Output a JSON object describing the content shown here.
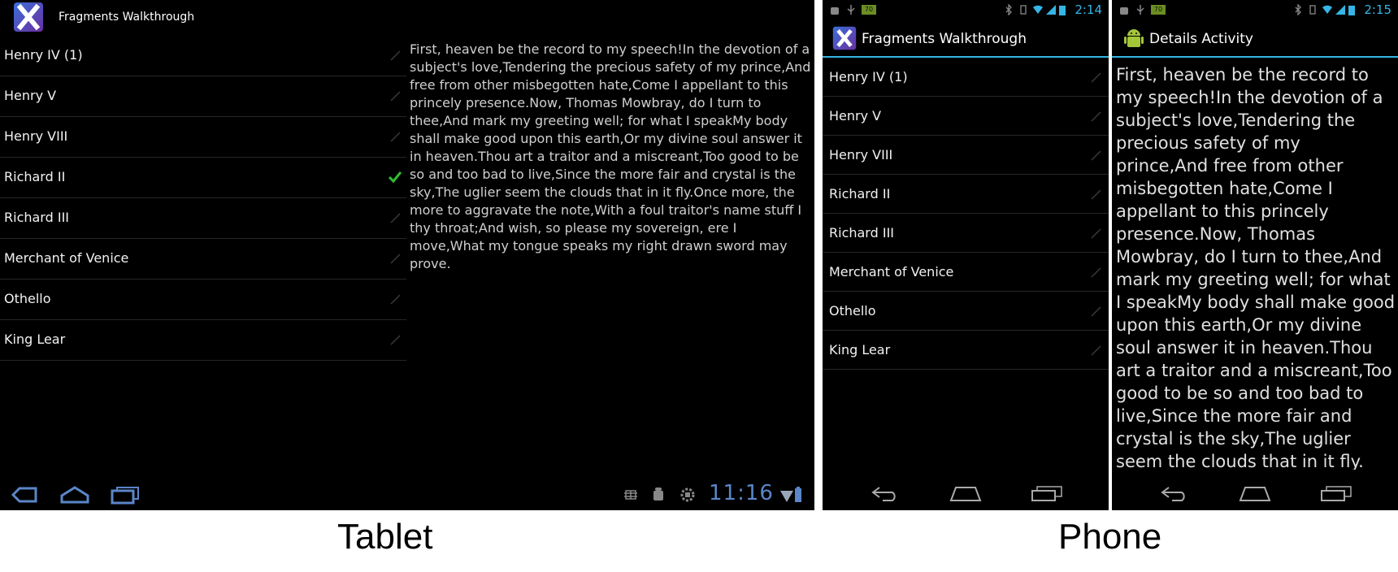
{
  "tablet": {
    "app_title": "Fragments Walkthrough",
    "list_items": [
      {
        "label": "Henry IV (1)",
        "checked": false
      },
      {
        "label": "Henry V",
        "checked": false
      },
      {
        "label": "Henry VIII",
        "checked": false
      },
      {
        "label": "Richard II",
        "checked": true
      },
      {
        "label": "Richard III",
        "checked": false
      },
      {
        "label": "Merchant of Venice",
        "checked": false
      },
      {
        "label": "Othello",
        "checked": false
      },
      {
        "label": "King Lear",
        "checked": false
      }
    ],
    "detail_text": "First, heaven be the record to my speech!In the devotion of a subject's love,Tendering the precious safety of my prince,And free from other misbegotten hate,Come I appellant to this princely presence.Now, Thomas Mowbray, do I turn to thee,And mark my greeting well; for what I speakMy body shall make good upon this earth,Or my divine soul answer it in heaven.Thou art a traitor and a miscreant,Too good to be so and too bad to live,Since the more fair and crystal is the sky,The uglier seem the clouds that in it fly.Once more, the more to aggravate the note,With a foul traitor's name stuff I thy throat;And wish, so please my sovereign, ere I move,What my tongue speaks my right drawn sword may prove.",
    "clock": "11:16",
    "nav_icons": [
      "back-icon",
      "home-icon",
      "recent-apps-icon"
    ],
    "status_icons": [
      "debug-icon",
      "android-icon",
      "usb-icon",
      "wifi-icon",
      "battery-icon"
    ]
  },
  "phone_list": {
    "clock": "2:14",
    "battery_badge": "70",
    "app_title": "Fragments Walkthrough",
    "list_items": [
      "Henry IV (1)",
      "Henry V",
      "Henry VIII",
      "Richard II",
      "Richard III",
      "Merchant of Venice",
      "Othello",
      "King Lear"
    ]
  },
  "phone_detail": {
    "clock": "2:15",
    "battery_badge": "70",
    "activity_title": "Details Activity",
    "detail_text": "First, heaven be the record to my speech!In the devotion of a subject's love,Tendering the precious safety of my prince,And free from other misbegotten hate,Come I appellant to this princely presence.Now, Thomas Mowbray, do I turn to thee,And mark my greeting well; for what I speakMy body shall make good upon this earth,Or my divine soul answer it in heaven.Thou art a traitor and a miscreant,Too good to be so and too bad to live,Since the more fair and crystal is the sky,The uglier seem the clouds that in it fly."
  },
  "captions": {
    "tablet": "Tablet",
    "phone": "Phone"
  },
  "colors": {
    "accent": "#33b5e5",
    "checkmark": "#2fbf2f",
    "clock_tablet": "#5b86c9"
  }
}
